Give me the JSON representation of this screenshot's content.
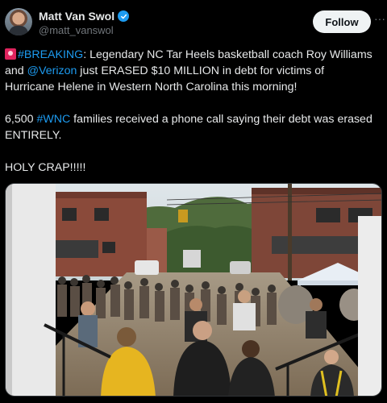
{
  "author": {
    "name": "Matt Van Swol",
    "handle": "@matt_vanswol",
    "verified_icon": "verified-badge-icon"
  },
  "follow_label": "Follow",
  "more_label": "···",
  "tweet": {
    "line1_hashtag": "#BREAKING",
    "line1_rest": ": Legendary NC Tar Heels basketball coach Roy Williams and ",
    "mention": "@Verizon",
    "line1_tail": " just ERASED $10 MILLION in debt for victims of Hurricane Helene in Western North Carolina this morning!",
    "para2_lead": "6,500 ",
    "para2_hashtag": "#WNC",
    "para2_rest": " families received a phone call saying their debt was erased ENTIRELY.",
    "para3": "HOLY CRAP!!!!!"
  },
  "colors": {
    "link": "#1d9bf0",
    "background": "#000000",
    "text": "#e7e9ea",
    "secondary": "#71767b"
  }
}
